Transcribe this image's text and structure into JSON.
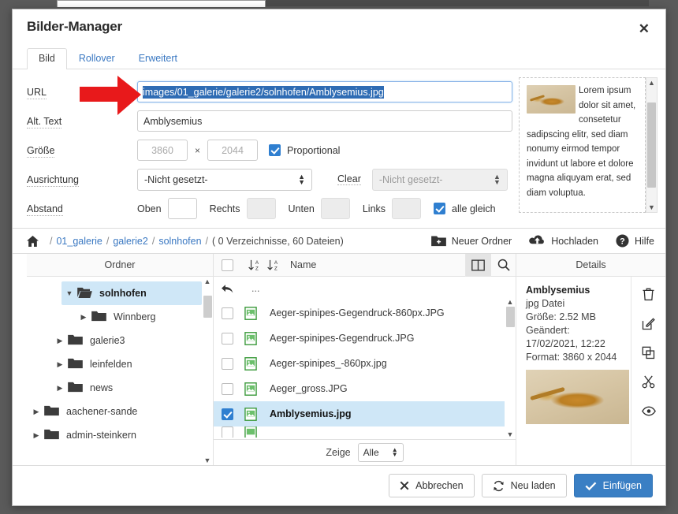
{
  "window": {
    "title": "Bilder-Manager",
    "close_label": "✕"
  },
  "tabs": [
    {
      "label": "Bild",
      "active": true
    },
    {
      "label": "Rollover",
      "active": false
    },
    {
      "label": "Erweitert",
      "active": false
    }
  ],
  "form": {
    "url": {
      "label": "URL",
      "value": "images/01_galerie/galerie2/solnhofen/Amblysemius.jpg",
      "selected": true
    },
    "alt": {
      "label": "Alt. Text",
      "value": "Amblysemius"
    },
    "size": {
      "label": "Größe",
      "width_placeholder": "3860",
      "height_placeholder": "2044",
      "times": "×",
      "proportional_label": "Proportional",
      "proportional_checked": true
    },
    "align": {
      "label": "Ausrichtung",
      "value": "-Nicht gesetzt-",
      "clear_label": "Clear",
      "clear_value": "-Nicht gesetzt-",
      "clear_disabled": true
    },
    "spacing": {
      "label": "Abstand",
      "top_label": "Oben",
      "right_label": "Rechts",
      "bottom_label": "Unten",
      "left_label": "Links",
      "top_value": "",
      "right_value": "",
      "bottom_value": "",
      "left_value": "",
      "all_equal_label": "alle gleich",
      "all_equal_checked": true
    }
  },
  "preview": {
    "text": "Lorem ipsum dolor sit amet, consetetur sadipscing elitr, sed diam nonumy eirmod tempor invidunt ut labore et dolore magna aliquyam erat, sed diam voluptua."
  },
  "breadcrumb": {
    "home_icon": "home-icon",
    "items": [
      "01_galerie",
      "galerie2",
      "solnhofen"
    ],
    "meta": "( 0 Verzeichnisse, 60 Dateien)",
    "separator": "/"
  },
  "toolbar": {
    "new_folder": "Neuer Ordner",
    "upload": "Hochladen",
    "help": "Hilfe"
  },
  "folders": {
    "header": "Ordner",
    "items": [
      {
        "label": "solnhofen",
        "depth": 2,
        "expanded": true,
        "selected": true
      },
      {
        "label": "Winnberg",
        "depth": 3,
        "expanded": false,
        "selected": false
      },
      {
        "label": "galerie3",
        "depth": 1,
        "expanded": false,
        "selected": false
      },
      {
        "label": "leinfelden",
        "depth": 1,
        "expanded": false,
        "selected": false
      },
      {
        "label": "news",
        "depth": 1,
        "expanded": false,
        "selected": false
      },
      {
        "label": "aachener-sande",
        "depth": 0,
        "expanded": false,
        "selected": false
      },
      {
        "label": "admin-steinkern",
        "depth": 0,
        "expanded": false,
        "selected": false
      }
    ]
  },
  "files": {
    "header_name": "Name",
    "select_all_checked": false,
    "parent_label": "...",
    "items": [
      {
        "label": "Aeger-spinipes-Gegendruck-860px.JPG",
        "checked": false,
        "selected": false
      },
      {
        "label": "Aeger-spinipes-Gegendruck.JPG",
        "checked": false,
        "selected": false
      },
      {
        "label": "Aeger-spinipes_-860px.jpg",
        "checked": false,
        "selected": false
      },
      {
        "label": "Aeger_gross.JPG",
        "checked": false,
        "selected": false
      },
      {
        "label": "Amblysemius.jpg",
        "checked": true,
        "selected": true
      }
    ],
    "footer": {
      "show_label": "Zeige",
      "show_value": "Alle"
    }
  },
  "details": {
    "header": "Details",
    "name": "Amblysemius",
    "type": "jpg Datei",
    "size": "Größe: 2.52 MB",
    "modified": "Geändert: 17/02/2021, 12:22",
    "format": "Format: 3860 x 2044",
    "tools": [
      "trash-icon",
      "edit-icon",
      "copy-icon",
      "cut-icon",
      "preview-icon"
    ]
  },
  "footer": {
    "cancel": "Abbrechen",
    "reload": "Neu laden",
    "insert": "Einfügen"
  },
  "colors": {
    "accent_blue": "#3a7fc4",
    "link_blue": "#3a78c2",
    "selection_blue": "#2f6cb4",
    "row_selected": "#cfe7f7",
    "arrow_red": "#e8191b"
  }
}
